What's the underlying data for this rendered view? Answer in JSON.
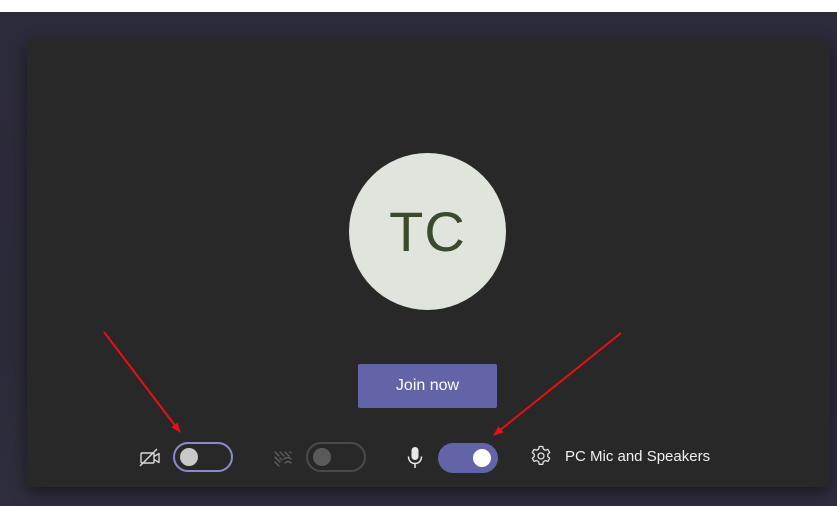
{
  "avatar": {
    "initials": "TC"
  },
  "join_button": {
    "label": "Join now"
  },
  "controls": {
    "video": {
      "icon": "video-off-icon",
      "toggle_state": "off"
    },
    "background_blur": {
      "icon": "background-blur-icon",
      "toggle_state": "off",
      "disabled": true
    },
    "microphone": {
      "icon": "microphone-icon",
      "toggle_state": "on"
    },
    "device_settings": {
      "icon": "gear-icon",
      "label": "PC Mic and Speakers"
    }
  },
  "annotations": {
    "arrow_color": "#e81010"
  },
  "colors": {
    "accent": "#6264a7",
    "panel_background": "#282828",
    "avatar_background": "#dfe5dc",
    "avatar_text": "#3a4a2c"
  }
}
